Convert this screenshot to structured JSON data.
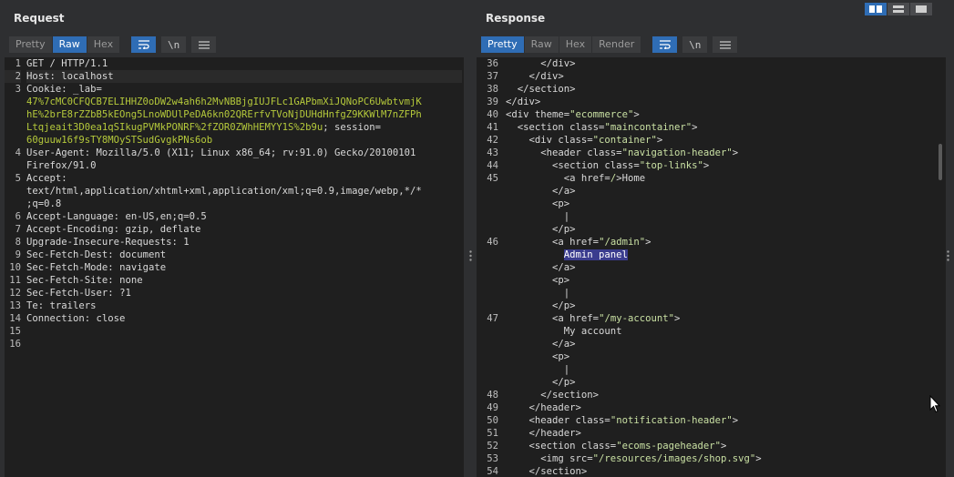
{
  "request": {
    "title": "Request",
    "tabs": [
      "Pretty",
      "Raw",
      "Hex"
    ],
    "active_tab": "Raw",
    "tools": [
      "wrap-icon",
      "\\n",
      "menu-icon"
    ],
    "lines": [
      {
        "n": "1",
        "parts": [
          {
            "t": "GET / HTTP/1.1",
            "c": "plain"
          }
        ]
      },
      {
        "n": "2",
        "parts": [
          {
            "t": "Host: ",
            "c": "key"
          },
          {
            "t": "localhost",
            "c": "plain"
          }
        ],
        "hl": true
      },
      {
        "n": "3",
        "parts": [
          {
            "t": "Cookie: ",
            "c": "key"
          },
          {
            "t": "_lab=",
            "c": "plain"
          }
        ]
      },
      {
        "n": "",
        "parts": [
          {
            "t": "47%7cMC0CFQCB7ELIHHZ0oDW2w4ah6h2MvNBBjgIUJFLc1GAPbmXiJQNoPC6UwbtvmjK",
            "c": "green"
          }
        ]
      },
      {
        "n": "",
        "parts": [
          {
            "t": "hE%2brE8rZZbB5kEOng5LnoWDUlPeDA6kn02QRErfvTVoNjDUHdHnfgZ9KKWlM7nZFPh",
            "c": "green"
          }
        ]
      },
      {
        "n": "",
        "parts": [
          {
            "t": "Ltqjeait3D0ea1qSIkugPVMkPONRF%2fZOR0ZWhHEMYY1S%2b9u",
            "c": "green"
          },
          {
            "t": "; session=",
            "c": "plain"
          }
        ]
      },
      {
        "n": "",
        "parts": [
          {
            "t": "60guuw16f9sTY8MOySTSudGvgkPNs6ob",
            "c": "green"
          }
        ]
      },
      {
        "n": "4",
        "parts": [
          {
            "t": "User-Agent: ",
            "c": "key"
          },
          {
            "t": "Mozilla/5.0 (X11; Linux x86_64; rv:91.0) Gecko/20100101",
            "c": "plain"
          }
        ]
      },
      {
        "n": "",
        "parts": [
          {
            "t": "Firefox/91.0",
            "c": "plain"
          }
        ]
      },
      {
        "n": "5",
        "parts": [
          {
            "t": "Accept:",
            "c": "key"
          }
        ]
      },
      {
        "n": "",
        "parts": [
          {
            "t": "text/html,application/xhtml+xml,application/xml;q=0.9,image/webp,*/*",
            "c": "plain"
          }
        ]
      },
      {
        "n": "",
        "parts": [
          {
            "t": ";q=0.8",
            "c": "plain"
          }
        ]
      },
      {
        "n": "6",
        "parts": [
          {
            "t": "Accept-Language: ",
            "c": "key"
          },
          {
            "t": "en-US,en;q=0.5",
            "c": "plain"
          }
        ]
      },
      {
        "n": "7",
        "parts": [
          {
            "t": "Accept-Encoding: ",
            "c": "key"
          },
          {
            "t": "gzip, deflate",
            "c": "plain"
          }
        ]
      },
      {
        "n": "8",
        "parts": [
          {
            "t": "Upgrade-Insecure-Requests: ",
            "c": "key"
          },
          {
            "t": "1",
            "c": "plain"
          }
        ]
      },
      {
        "n": "9",
        "parts": [
          {
            "t": "Sec-Fetch-Dest: ",
            "c": "key"
          },
          {
            "t": "document",
            "c": "plain"
          }
        ]
      },
      {
        "n": "10",
        "parts": [
          {
            "t": "Sec-Fetch-Mode: ",
            "c": "key"
          },
          {
            "t": "navigate",
            "c": "plain"
          }
        ]
      },
      {
        "n": "11",
        "parts": [
          {
            "t": "Sec-Fetch-Site: ",
            "c": "key"
          },
          {
            "t": "none",
            "c": "plain"
          }
        ]
      },
      {
        "n": "12",
        "parts": [
          {
            "t": "Sec-Fetch-User: ",
            "c": "key"
          },
          {
            "t": "?1",
            "c": "plain"
          }
        ]
      },
      {
        "n": "13",
        "parts": [
          {
            "t": "Te: ",
            "c": "key"
          },
          {
            "t": "trailers",
            "c": "plain"
          }
        ]
      },
      {
        "n": "14",
        "parts": [
          {
            "t": "Connection: ",
            "c": "key"
          },
          {
            "t": "close",
            "c": "plain"
          }
        ]
      },
      {
        "n": "15",
        "parts": []
      },
      {
        "n": "16",
        "parts": []
      }
    ]
  },
  "response": {
    "title": "Response",
    "tabs": [
      "Pretty",
      "Raw",
      "Hex",
      "Render"
    ],
    "active_tab": "Pretty",
    "tools": [
      "wrap-icon",
      "\\n",
      "menu-icon"
    ],
    "lines": [
      {
        "n": "36",
        "parts": [
          {
            "t": "      </div>",
            "c": "plain"
          }
        ]
      },
      {
        "n": "37",
        "parts": [
          {
            "t": "    </div>",
            "c": "plain"
          }
        ]
      },
      {
        "n": "38",
        "parts": [
          {
            "t": "  </section>",
            "c": "plain"
          }
        ]
      },
      {
        "n": "39",
        "parts": [
          {
            "t": "</div>",
            "c": "plain"
          }
        ]
      },
      {
        "n": "40",
        "parts": [
          {
            "t": "<div theme=",
            "c": "plain"
          },
          {
            "t": "\"ecommerce\"",
            "c": "str"
          },
          {
            "t": ">",
            "c": "plain"
          }
        ]
      },
      {
        "n": "41",
        "parts": [
          {
            "t": "  <section class=",
            "c": "plain"
          },
          {
            "t": "\"maincontainer\"",
            "c": "str"
          },
          {
            "t": ">",
            "c": "plain"
          }
        ]
      },
      {
        "n": "42",
        "parts": [
          {
            "t": "    <div class=",
            "c": "plain"
          },
          {
            "t": "\"container\"",
            "c": "str"
          },
          {
            "t": ">",
            "c": "plain"
          }
        ]
      },
      {
        "n": "43",
        "parts": [
          {
            "t": "      <header class=",
            "c": "plain"
          },
          {
            "t": "\"navigation-header\"",
            "c": "str"
          },
          {
            "t": ">",
            "c": "plain"
          }
        ]
      },
      {
        "n": "44",
        "parts": [
          {
            "t": "        <section class=",
            "c": "plain"
          },
          {
            "t": "\"top-links\"",
            "c": "str"
          },
          {
            "t": ">",
            "c": "plain"
          }
        ]
      },
      {
        "n": "45",
        "parts": [
          {
            "t": "          <a href=",
            "c": "plain"
          },
          {
            "t": "/",
            "c": "str"
          },
          {
            "t": ">Home",
            "c": "plain"
          }
        ]
      },
      {
        "n": "",
        "parts": [
          {
            "t": "        </a>",
            "c": "plain"
          }
        ]
      },
      {
        "n": "",
        "parts": [
          {
            "t": "        <p>",
            "c": "plain"
          }
        ]
      },
      {
        "n": "",
        "parts": [
          {
            "t": "          |",
            "c": "plain"
          }
        ]
      },
      {
        "n": "",
        "parts": [
          {
            "t": "        </p>",
            "c": "plain"
          }
        ]
      },
      {
        "n": "46",
        "parts": [
          {
            "t": "        <a href=",
            "c": "plain"
          },
          {
            "t": "\"/admin\"",
            "c": "str"
          },
          {
            "t": ">",
            "c": "plain"
          }
        ]
      },
      {
        "n": "",
        "parts": [
          {
            "t": "          ",
            "c": "plain"
          },
          {
            "t": "Admin panel",
            "c": "sel"
          }
        ]
      },
      {
        "n": "",
        "parts": [
          {
            "t": "        </a>",
            "c": "plain"
          }
        ]
      },
      {
        "n": "",
        "parts": [
          {
            "t": "        <p>",
            "c": "plain"
          }
        ]
      },
      {
        "n": "",
        "parts": [
          {
            "t": "          |",
            "c": "plain"
          }
        ]
      },
      {
        "n": "",
        "parts": [
          {
            "t": "        </p>",
            "c": "plain"
          }
        ]
      },
      {
        "n": "47",
        "parts": [
          {
            "t": "        <a href=",
            "c": "plain"
          },
          {
            "t": "\"/my-account\"",
            "c": "str"
          },
          {
            "t": ">",
            "c": "plain"
          }
        ]
      },
      {
        "n": "",
        "parts": [
          {
            "t": "          My account",
            "c": "plain"
          }
        ]
      },
      {
        "n": "",
        "parts": [
          {
            "t": "        </a>",
            "c": "plain"
          }
        ]
      },
      {
        "n": "",
        "parts": [
          {
            "t": "        <p>",
            "c": "plain"
          }
        ]
      },
      {
        "n": "",
        "parts": [
          {
            "t": "          |",
            "c": "plain"
          }
        ]
      },
      {
        "n": "",
        "parts": [
          {
            "t": "        </p>",
            "c": "plain"
          }
        ]
      },
      {
        "n": "48",
        "parts": [
          {
            "t": "      </section>",
            "c": "plain"
          }
        ]
      },
      {
        "n": "49",
        "parts": [
          {
            "t": "    </header>",
            "c": "plain"
          }
        ]
      },
      {
        "n": "50",
        "parts": [
          {
            "t": "    <header class=",
            "c": "plain"
          },
          {
            "t": "\"notification-header\"",
            "c": "str"
          },
          {
            "t": ">",
            "c": "plain"
          }
        ]
      },
      {
        "n": "51",
        "parts": [
          {
            "t": "    </header>",
            "c": "plain"
          }
        ]
      },
      {
        "n": "52",
        "parts": [
          {
            "t": "    <section class=",
            "c": "plain"
          },
          {
            "t": "\"ecoms-pageheader\"",
            "c": "str"
          },
          {
            "t": ">",
            "c": "plain"
          }
        ]
      },
      {
        "n": "53",
        "parts": [
          {
            "t": "      <img src=",
            "c": "plain"
          },
          {
            "t": "\"/resources/images/shop.svg\"",
            "c": "str"
          },
          {
            "t": ">",
            "c": "plain"
          }
        ]
      },
      {
        "n": "54",
        "parts": [
          {
            "t": "    </section>",
            "c": "plain"
          }
        ]
      }
    ]
  },
  "colors": {
    "accent": "#2f6db5",
    "string": "#c9e0a3",
    "cookie_value": "#b5c93b",
    "selection": "#3a3c8e"
  }
}
